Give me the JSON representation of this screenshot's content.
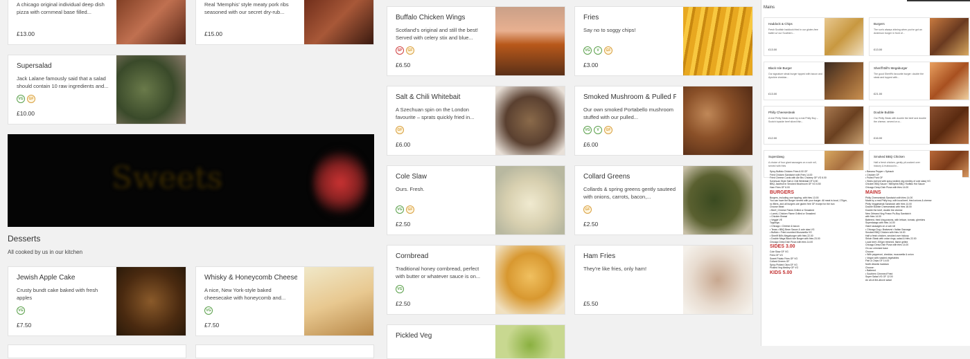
{
  "left_top_cards": [
    {
      "name": "",
      "desc": "A chicago original individual deep dish pizza with cornmeal base filled...",
      "price": "£13.00",
      "icons": []
    },
    {
      "name": "",
      "desc": "Real 'Memphis' style meaty pork ribs seasoned with our secret dry-rub...",
      "price": "£15.00",
      "icons": []
    }
  ],
  "supersalad": {
    "name": "Supersalad",
    "desc": "Jack Lalane famously said that a salad should contain 10 raw ingredients and...",
    "price": "£10.00",
    "icons": [
      "VG",
      "GF"
    ]
  },
  "banner": {
    "text": "Sweets"
  },
  "desserts": {
    "title": "Desserts",
    "subtitle": "All cooked by us in our kitchen",
    "items": [
      {
        "name": "Jewish Apple Cake",
        "desc": "Crusty bundt cake baked with fresh apples",
        "price": "£7.50",
        "icons": [
          "VG"
        ]
      },
      {
        "name": "Whisky & Honeycomb Cheesecake",
        "desc": "A nice, New York-style baked cheesecake with honeycomb and...",
        "price": "£7.50",
        "icons": [
          "VG"
        ]
      }
    ]
  },
  "sides": [
    {
      "name": "Buffalo Chicken Wings",
      "desc": "Scotland's original and still the best! Served with celery stix and blue...",
      "price": "£6.50",
      "icons": [
        "SP",
        "GF"
      ]
    },
    {
      "name": "Fries",
      "desc": "Say no to soggy chips!",
      "price": "£3.00",
      "icons": [
        "VG",
        "V",
        "GF"
      ]
    },
    {
      "name": "Salt & Chili Whitebait",
      "desc": "A Szechuan spin on the London favourite – sprats quickly fried in...",
      "price": "£6.00",
      "icons": [
        "GF"
      ]
    },
    {
      "name": "Smoked Mushroom & Pulled Pork",
      "desc": "Our own smoked Portabello mushroom stuffed with our pulled...",
      "price": "£6.00",
      "icons": [
        "VG",
        "V",
        "GF"
      ]
    },
    {
      "name": "Cole Slaw",
      "desc": "Ours. Fresh.",
      "price": "£2.50",
      "icons": [
        "VG",
        "GF"
      ]
    },
    {
      "name": "Collard Greens",
      "desc": "Collards & spring greens gently sauteed with onions, carrots, bacon,...",
      "price": "£2.50",
      "icons": [
        "GF"
      ]
    },
    {
      "name": "Cornbread",
      "desc": "Traditional honey cornbread, perfect with butter or whatever sauce is on...",
      "price": "£2.50",
      "icons": [
        "VG"
      ]
    },
    {
      "name": "Ham Fries",
      "desc": "They're like fries, only ham!",
      "price": "£5.50",
      "icons": []
    },
    {
      "name": "Pickled Veg",
      "desc": "",
      "price": "",
      "icons": []
    }
  ],
  "right_panel": {
    "section_label": "Mains",
    "items": [
      {
        "name": "Haddock & Chips",
        "desc": "Fresh Scottish haddock fried in our gluten-free batter w/ our Southern...",
        "price": "£13.00"
      },
      {
        "name": "Burgers",
        "desc": "The sun's always shining when you've got an Anderson burger in front of...",
        "price": "£13.00"
      },
      {
        "name": "Black Isle Burger",
        "desc": "Our signature steak burger topped with bacon and Ayrshire cheddar...",
        "price": "£13.00"
      },
      {
        "name": "Sheriff Bill's Megaburger",
        "desc": "The good Sheriff's favourite burger: double the steak and topped with...",
        "price": "£21.00"
      },
      {
        "name": "Philly Cheesesteak",
        "desc": "A real Philly Steak made by a real Philly Boy – Scotch topside beef sliced thin...",
        "price": "£12.00"
      },
      {
        "name": "Double Bubble",
        "desc": "Our Philly Steak with double the beef and double the cheese, served on a...",
        "price": "£16.00"
      },
      {
        "name": "Superdawg",
        "desc": "A choice of four giant sausages on a sub roll, served with fries",
        "price": ""
      },
      {
        "name": "Smoked BBQ Chicken",
        "desc": "Half a fresh chicken, gently pit-cooked over hickory & fruitwood in...",
        "price": ""
      }
    ],
    "doc_left_lines": [
      "Spicy Buffalo Chicken Fries 6.00 GF",
      "Fried Chicken Sandwich with Fries 14.00",
      "Fried Cheese Curds with Ale Bru Chutney GF VG 6.00",
      "Szechuan Style Salt & Chili Whitebait GF 6.50",
      "BBQ Jackfruit in Smoked Mushroom GF VG 6.50",
      "Ham Fries GF 6.00",
      "BURGERS",
      "Burgers, including one topping, with fries 13.00",
      "You can have the Burger served with your burger. All meat is local, 170gm,",
      "no fillers, and all burgers are gluten free GF except for the bun",
      "Choose Meat:",
      "• Beef  | Cheese Flame-Grilled or Smashed",
      "• Lamb  | Chicken Flame Grilled or Smashed",
      "• Chicken Breast",
      "• Veggie VE",
      "Toppings:",
      "• Chicago • Cheese & bacon",
      "• Texas • BBQ Bean Sauce & cole slaw VG",
      "• Buffalo • Fried crumbed Mozzarella VG",
      "• Sheriff Bill's Megaburger with fries 22.00",
      "• Double Mega Black Isle Burger with fries 23.00",
      "Chicago Deep Dish Pizza with fries 14.00",
      "SIDES 3.00",
      "Cole Slaw GF VG",
      "Fries GF VG",
      "Sweet Potato Fries GF VG",
      "Collard Greens GF",
      "Spicy Pickled Okra GF VG",
      "Pickled Veg Medley GF VG",
      "KIDS 5.00"
    ],
    "doc_right_lines": [
      "• Banana Pepper • Spinach",
      "• Chicken GF",
      "• Pulled Pork GF",
      "• Sides (served with spicy pickled veg medley of cole slaw) VG",
      "Chicken BBQ Sauce / Memphis BBQ / Buffalo Hot Sauce",
      "Chicago Deep Dish Pizza with fries 14.00",
      "MAINS",
      "Philly Cheesesteak Sandwich with fries 14.00",
      "Made by a real Philly boy, with local beef, fried onions & cheese",
      "Philly Veggiesteak Sandwich with fries 14.00",
      "Double Bubble Cheesesteak with fries 18.00",
      "Double the beef, double the cheese",
      "New Orleans King Prawn Po-Boy Sandwich",
      "with fries 14.00",
      "Battered, fried king prawns, with lettuce, tomato, gherkins",
      "Superdawgs with fries 14.00",
      "Giant sausages on a sub roll",
      "• Chicago Dog • Bratwurst • Italian Sausage",
      "Smoked BBQ Chicken with fries 16.00",
      "Half a fresh chicken, smoked over hickory",
      "Sirloin Steak with onion rings, salad & fries 22.00",
      "Local beef, 200gm trimmed, flame grilled",
      "Chicago Deep Dish Pizza with fries 14.00",
      "On our crimmed base",
      "Choose:",
      "• With pepperoni, cheddar, mozzarella & onion",
      "• Vegan with roasted vegetables",
      "Fish & Chips GF 14.00",
      "North Atlantic haddock",
      "Choose:",
      "• Battered",
      "• Southern Crimmed Fried",
      "Super Salad VG GF 12.00",
      "An all-of-the-above salad"
    ]
  },
  "colors": {
    "accent_red": "#c22222",
    "veg_green": "#5aa04a",
    "gf_orange": "#d9a040"
  }
}
